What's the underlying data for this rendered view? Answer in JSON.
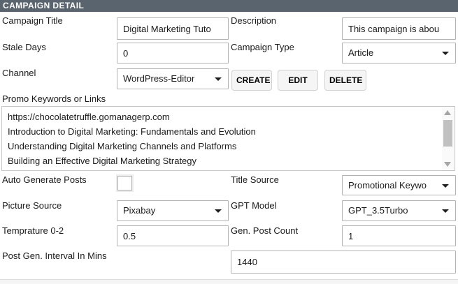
{
  "header": {
    "title": "CAMPAIGN DETAIL"
  },
  "colors": {
    "header_bg": "#5a646e",
    "header_text": "#ffffff",
    "field_border": "#b3b3b3",
    "button_bg": "#f5f5f5"
  },
  "form": {
    "campaign_title": {
      "label": "Campaign Title",
      "value": "Digital Marketing Tuto"
    },
    "description": {
      "label": "Description",
      "value": "This campaign is abou"
    },
    "stale_days": {
      "label": "Stale Days",
      "value": "0"
    },
    "campaign_type": {
      "label": "Campaign Type",
      "value": "Article"
    },
    "channel": {
      "label": "Channel",
      "value": "WordPress-Editor"
    },
    "actions": {
      "create": "CREATE",
      "edit": "EDIT",
      "delete": "DELETE"
    },
    "promo_keywords": {
      "label": "Promo Keywords or Links",
      "lines": [
        "https://chocolatetruffle.gomanagerp.com",
        "Introduction to Digital Marketing: Fundamentals and Evolution",
        "Understanding Digital Marketing Channels and Platforms",
        "Building an Effective Digital Marketing Strategy"
      ]
    },
    "auto_generate_posts": {
      "label": "Auto Generate Posts",
      "checked": false
    },
    "title_source": {
      "label": "Title Source",
      "value": "Promotional Keywo"
    },
    "picture_source": {
      "label": "Picture Source",
      "value": "Pixabay"
    },
    "gpt_model": {
      "label": "GPT Model",
      "value": "GPT_3.5Turbo"
    },
    "temprature": {
      "label": "Temprature 0-2",
      "value": "0.5"
    },
    "gen_post_count": {
      "label": "Gen. Post Count",
      "value": "1"
    },
    "post_gen_interval": {
      "label": "Post Gen. Interval In Mins",
      "value": "1440"
    }
  }
}
